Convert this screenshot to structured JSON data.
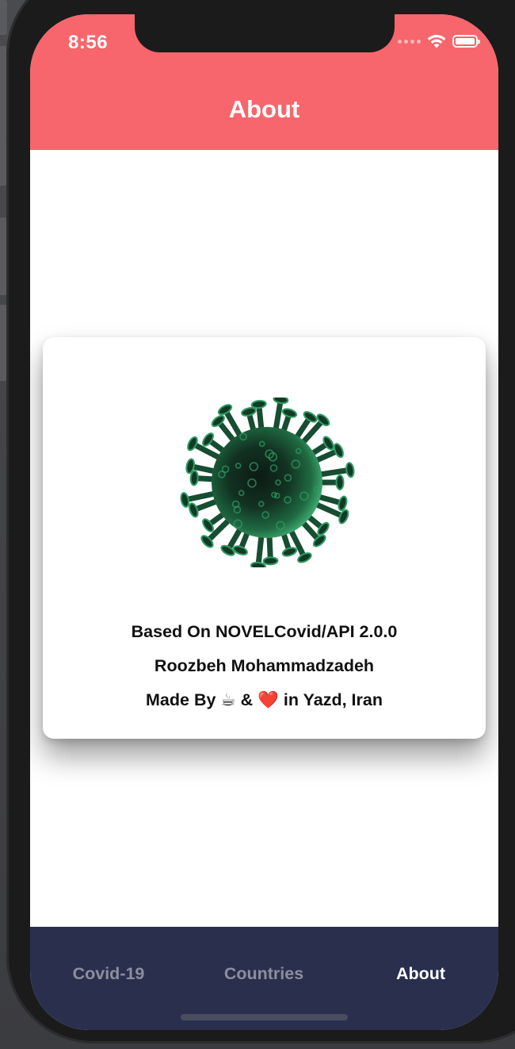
{
  "status_bar": {
    "time": "8:56"
  },
  "header": {
    "title": "About"
  },
  "card": {
    "image": "coronavirus-illustration",
    "lines": [
      "Based On NOVELCovid/API 2.0.0",
      "Roozbeh Mohammadzadeh",
      "Made By ☕ & ❤️ in Yazd, Iran"
    ]
  },
  "tabs": [
    {
      "label": "Covid-19",
      "active": false
    },
    {
      "label": "Countries",
      "active": false
    },
    {
      "label": "About",
      "active": true
    }
  ],
  "colors": {
    "header_bg": "#f7666c",
    "tab_bar_bg": "#292f4d",
    "tab_inactive": "#8b8f9e",
    "tab_active": "#ffffff",
    "virus_green": "#2f9b63"
  },
  "icons": {
    "wifi": "wifi-icon",
    "battery": "battery-icon",
    "signal": "cellular-signal-icon"
  }
}
